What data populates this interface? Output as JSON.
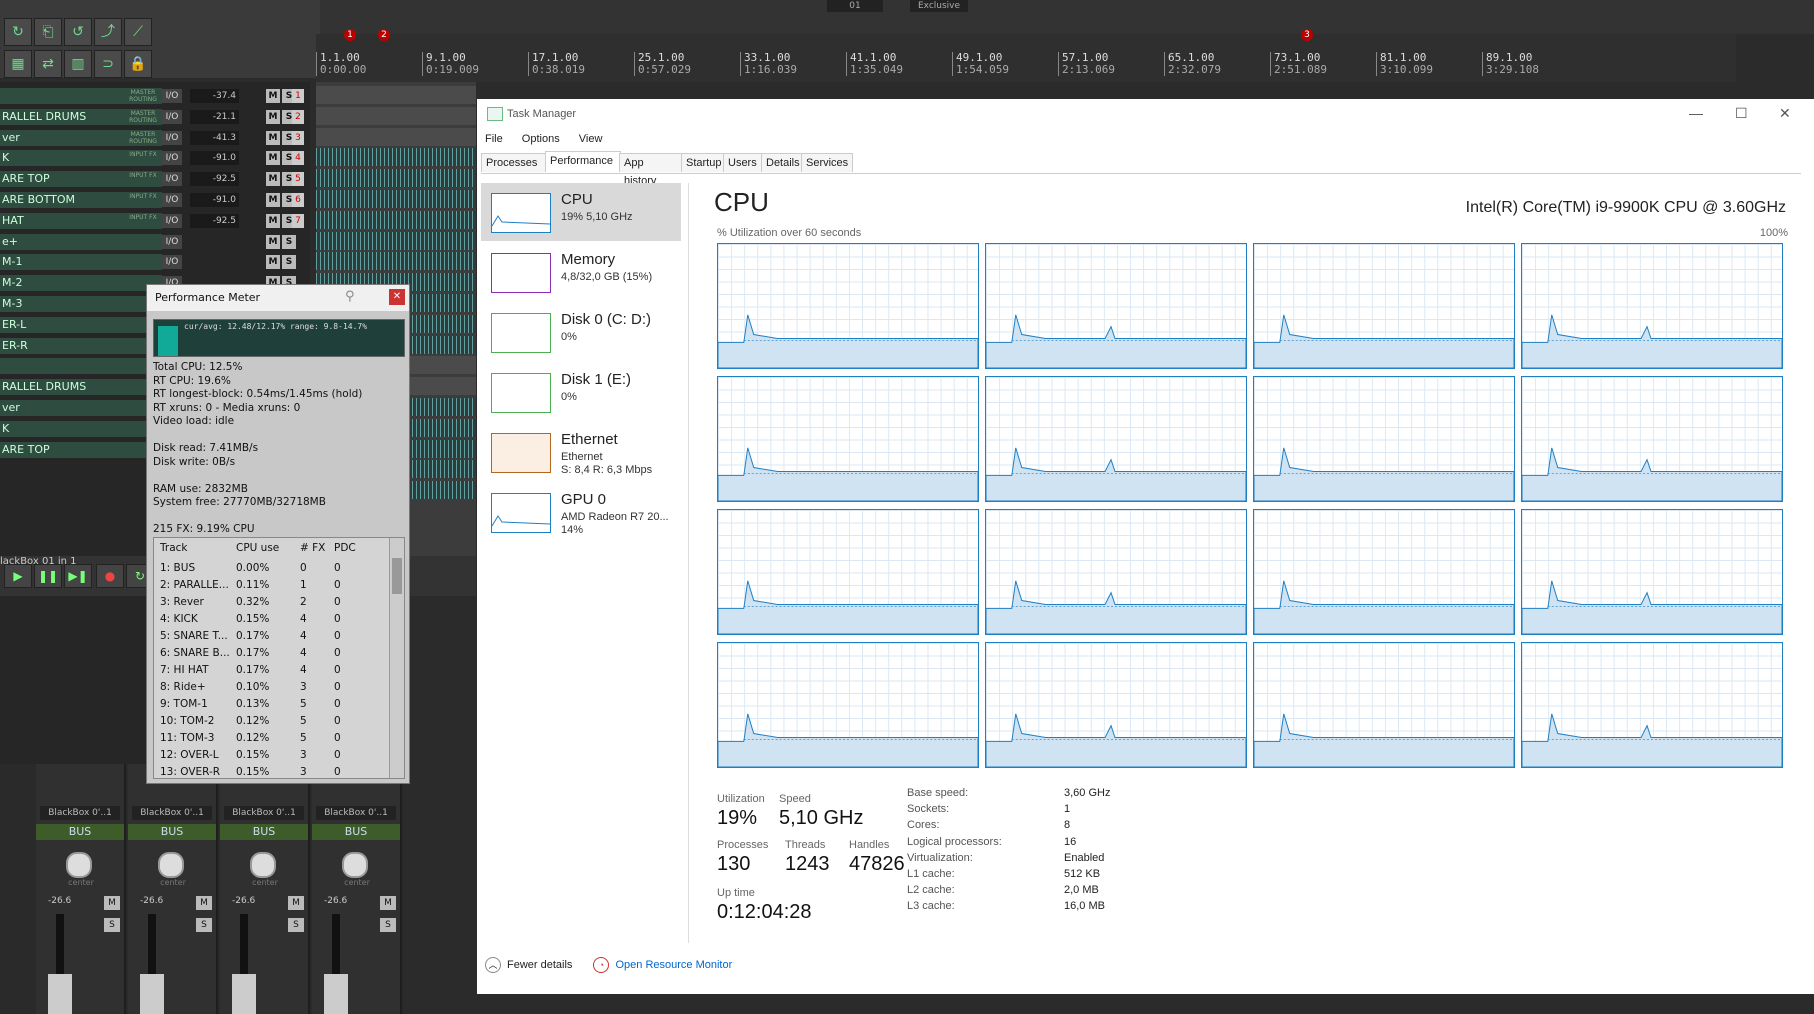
{
  "reaper": {
    "top_segments": [
      "01",
      "Exclusive"
    ],
    "ruler": [
      {
        "bar": "1.1.00",
        "time": "0:00.00"
      },
      {
        "bar": "9.1.00",
        "time": "0:19.009"
      },
      {
        "bar": "17.1.00",
        "time": "0:38.019"
      },
      {
        "bar": "25.1.00",
        "time": "0:57.029"
      },
      {
        "bar": "33.1.00",
        "time": "1:16.039"
      },
      {
        "bar": "41.1.00",
        "time": "1:35.049"
      },
      {
        "bar": "49.1.00",
        "time": "1:54.059"
      },
      {
        "bar": "57.1.00",
        "time": "2:13.069"
      },
      {
        "bar": "65.1.00",
        "time": "2:32.079"
      },
      {
        "bar": "73.1.00",
        "time": "2:51.089"
      },
      {
        "bar": "81.1.00",
        "time": "3:10.099"
      },
      {
        "bar": "89.1.00",
        "time": "3:29.108"
      }
    ],
    "markers": [
      "1",
      "2",
      "3"
    ],
    "tracks": [
      {
        "name": "",
        "tag": "MASTER ROUTING",
        "vol": "-37.4",
        "num": "1"
      },
      {
        "name": "RALLEL DRUMS",
        "tag": "MASTER ROUTING",
        "vol": "-21.1",
        "num": "2"
      },
      {
        "name": "ver",
        "tag": "MASTER ROUTING",
        "vol": "-41.3",
        "num": "3"
      },
      {
        "name": "K",
        "tag": "INPUT FX",
        "vol": "-91.0",
        "num": "4"
      },
      {
        "name": "ARE TOP",
        "tag": "INPUT FX",
        "vol": "-92.5",
        "num": "5"
      },
      {
        "name": "ARE BOTTOM",
        "tag": "INPUT FX",
        "vol": "-91.0",
        "num": "6"
      },
      {
        "name": "HAT",
        "tag": "INPUT FX",
        "vol": "-92.5",
        "num": "7"
      },
      {
        "name": "e+",
        "tag": "",
        "vol": "",
        "num": ""
      },
      {
        "name": "M-1",
        "tag": "",
        "vol": "",
        "num": ""
      },
      {
        "name": "M-2",
        "tag": "",
        "vol": "",
        "num": ""
      },
      {
        "name": "M-3",
        "tag": "",
        "vol": "",
        "num": ""
      },
      {
        "name": "ER-L",
        "tag": "",
        "vol": "",
        "num": ""
      },
      {
        "name": "ER-R",
        "tag": "",
        "vol": "",
        "num": ""
      },
      {
        "name": "",
        "tag": "",
        "vol": "",
        "num": ""
      },
      {
        "name": "RALLEL DRUMS",
        "tag": "",
        "vol": "",
        "num": ""
      },
      {
        "name": "ver",
        "tag": "",
        "vol": "",
        "num": ""
      },
      {
        "name": "K",
        "tag": "",
        "vol": "",
        "num": ""
      },
      {
        "name": "ARE TOP",
        "tag": "",
        "vol": "",
        "num": ""
      }
    ],
    "transport_label": "lackBox 01 in 1",
    "mute_label": "M",
    "solo_label": "S",
    "io_label": "I/O",
    "fx_label": "FX",
    "mixer_strips": [
      {
        "plugin": "BlackBox 0'..1",
        "bus": "BUS",
        "pan": "center",
        "db": "-26.6"
      },
      {
        "plugin": "BlackBox 0'..1",
        "bus": "BUS",
        "pan": "center",
        "db": "-26.6"
      },
      {
        "plugin": "BlackBox 0'..1",
        "bus": "BUS",
        "pan": "center",
        "db": "-26.6"
      },
      {
        "plugin": "BlackBox 0'..1",
        "bus": "BUS",
        "pan": "center",
        "db": "-26.6"
      }
    ],
    "mixer_first_plugin": "BlackBox 0'..1"
  },
  "perf_meter": {
    "title": "Performance Meter",
    "graph_text": "cur/avg: 12.48/12.17%  range: 9.8-14.7%",
    "stats": [
      "Total CPU: 12.5%",
      "RT CPU: 19.6%",
      "RT longest-block: 0.54ms/1.45ms (hold)",
      "RT xruns: 0 - Media xruns: 0",
      "Video load: idle",
      "",
      "Disk read: 7.41MB/s",
      "Disk write: 0B/s",
      "",
      "RAM use: 2832MB",
      "System free: 27770MB/32718MB",
      "",
      "215 FX: 9.19% CPU"
    ],
    "columns": [
      "Track",
      "CPU use",
      "# FX",
      "PDC"
    ],
    "rows": [
      [
        "1: BUS",
        "0.00%",
        "0",
        "0"
      ],
      [
        "2: PARALLE...",
        "0.11%",
        "1",
        "0"
      ],
      [
        "3: Rever",
        "0.32%",
        "2",
        "0"
      ],
      [
        "4: KICK",
        "0.15%",
        "4",
        "0"
      ],
      [
        "5: SNARE T...",
        "0.17%",
        "4",
        "0"
      ],
      [
        "6: SNARE B...",
        "0.17%",
        "4",
        "0"
      ],
      [
        "7: HI HAT",
        "0.17%",
        "4",
        "0"
      ],
      [
        "8: Ride+",
        "0.10%",
        "3",
        "0"
      ],
      [
        "9: TOM-1",
        "0.13%",
        "5",
        "0"
      ],
      [
        "10: TOM-2",
        "0.12%",
        "5",
        "0"
      ],
      [
        "11: TOM-3",
        "0.12%",
        "5",
        "0"
      ],
      [
        "12: OVER-L",
        "0.15%",
        "3",
        "0"
      ],
      [
        "13: OVER-R",
        "0.15%",
        "3",
        "0"
      ]
    ]
  },
  "task_manager": {
    "title": "Task Manager",
    "menu": [
      "File",
      "Options",
      "View"
    ],
    "tabs": [
      "Processes",
      "Performance",
      "App history",
      "Startup",
      "Users",
      "Details",
      "Services"
    ],
    "active_tab": "Performance",
    "sidebar": [
      {
        "name": "CPU",
        "line1": "19% 5,10 GHz",
        "line2": "",
        "color": "#1e7fc4"
      },
      {
        "name": "Memory",
        "line1": "4,8/32,0 GB (15%)",
        "line2": "",
        "color": "#8b2fb0"
      },
      {
        "name": "Disk 0 (C: D:)",
        "line1": "0%",
        "line2": "",
        "color": "#4caf50"
      },
      {
        "name": "Disk 1 (E:)",
        "line1": "0%",
        "line2": "",
        "color": "#4caf50"
      },
      {
        "name": "Ethernet",
        "line1": "Ethernet",
        "line2": "S: 8,4  R: 6,3 Mbps",
        "color": "#b5651d"
      },
      {
        "name": "GPU 0",
        "line1": "AMD Radeon R7 20...",
        "line2": "14%",
        "color": "#1e7fc4"
      }
    ],
    "heading": "CPU",
    "cpu_model": "Intel(R) Core(TM) i9-9900K CPU @ 3.60GHz",
    "graph_caption": "% Utilization over 60 seconds",
    "graph_max": "100%",
    "core_graphs": 16,
    "stats": {
      "utilization_label": "Utilization",
      "utilization": "19%",
      "speed_label": "Speed",
      "speed": "5,10 GHz",
      "processes_label": "Processes",
      "processes": "130",
      "threads_label": "Threads",
      "threads": "1243",
      "handles_label": "Handles",
      "handles": "47826",
      "uptime_label": "Up time",
      "uptime": "0:12:04:28"
    },
    "specs": [
      [
        "Base speed:",
        "3,60 GHz"
      ],
      [
        "Sockets:",
        "1"
      ],
      [
        "Cores:",
        "8"
      ],
      [
        "Logical processors:",
        "16"
      ],
      [
        "Virtualization:",
        "Enabled"
      ],
      [
        "L1 cache:",
        "512 KB"
      ],
      [
        "L2 cache:",
        "2,0 MB"
      ],
      [
        "L3 cache:",
        "16,0 MB"
      ]
    ],
    "fewer_details": "Fewer details",
    "resource_monitor": "Open Resource Monitor"
  }
}
